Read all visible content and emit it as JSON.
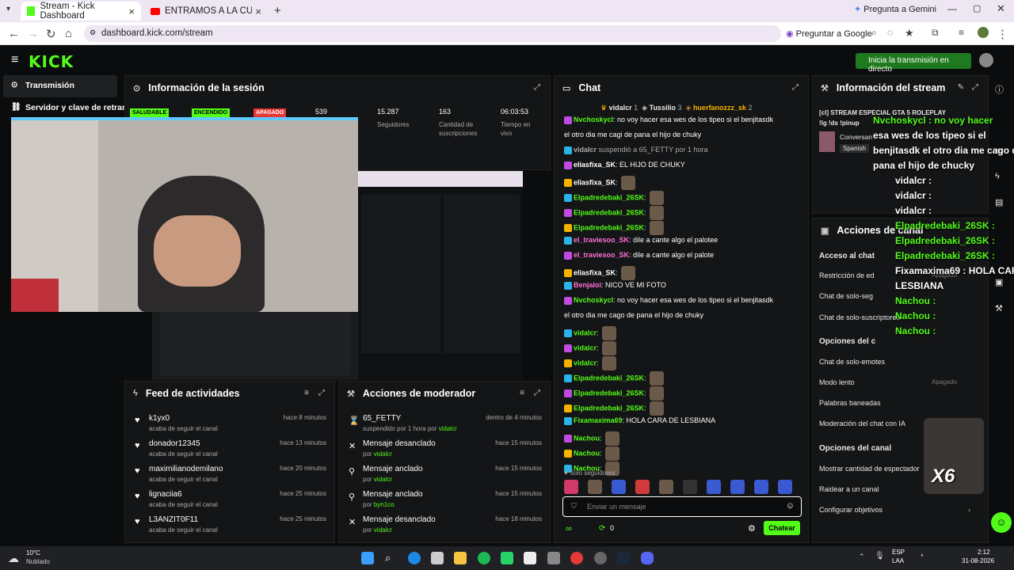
{
  "browser": {
    "tabs": [
      {
        "label": "Stream - Kick Dashboard"
      },
      {
        "label": "ENTRAMOS A LA CUEVA DE LA"
      }
    ],
    "gemini_btn": "Pregunta a Gemini",
    "url": "dashboard.kick.com/stream",
    "ask_google": "Preguntar a Google"
  },
  "kick": {
    "logo": "KICK",
    "start_btn": "Inicia la transmisión en directo"
  },
  "sidebar": {
    "items": [
      {
        "label": "Transmisión"
      },
      {
        "label": "Servidor y clave de retran"
      }
    ]
  },
  "session": {
    "title": "Información de la sesión",
    "tags": [
      "SALUDABLE",
      "ENCENDIDO",
      "APAGADO"
    ],
    "viewers": "539",
    "stats": [
      {
        "value": "15.287",
        "label": "Seguidores"
      },
      {
        "value": "163",
        "label": "Cantidad de suscripciones"
      },
      {
        "value": "06:03:53",
        "label": "Tiempo en vivo"
      }
    ]
  },
  "feed": {
    "title": "Feed de actividades",
    "items": [
      {
        "name": "k1yx0",
        "sub": "acaba de seguir el canal",
        "time": "hace 8 minutos"
      },
      {
        "name": "donador12345",
        "sub": "acaba de seguir el canal",
        "time": "hace 13 minutos"
      },
      {
        "name": "maximilianodemilano",
        "sub": "acaba de seguir el canal",
        "time": "hace 20 minutos"
      },
      {
        "name": "lignaciia6",
        "sub": "acaba de seguir el canal",
        "time": "hace 25 minutos"
      },
      {
        "name": "L3ANZIT0F11",
        "sub": "acaba de seguir el canal",
        "time": "hace 25 minutos"
      }
    ]
  },
  "mod": {
    "title": "Acciones de moderador",
    "items": [
      {
        "name": "65_FETTY",
        "sub": "suspendido por 1 hora por ",
        "by": "vidalcr",
        "time": "dentro de 4 minutos"
      },
      {
        "name": "Mensaje desanclado",
        "sub": "por ",
        "by": "vidalcr",
        "time": "hace 15 minutos"
      },
      {
        "name": "Mensaje anclado",
        "sub": "por ",
        "by": "vidalcr",
        "time": "hace 15 minutos"
      },
      {
        "name": "Mensaje anclado",
        "sub": "por ",
        "by": "byn1co",
        "time": "hace 15 minutos"
      },
      {
        "name": "Mensaje desanclado",
        "sub": "por ",
        "by": "vidalcr",
        "time": "hace 18 minutos"
      }
    ]
  },
  "chat": {
    "title": "Chat",
    "top": [
      {
        "name": "vidalcr",
        "n": "1"
      },
      {
        "name": "Tussilio",
        "n": "3"
      },
      {
        "name": "huerfanozzz_sk",
        "n": "2"
      }
    ],
    "msgs": [
      {
        "user": "Nvchoskycl",
        "color": "#53fc18",
        "text": ": no voy hacer esa wes de los tipeo si el benjitasdk"
      },
      {
        "user": "",
        "color": "#fff",
        "text": "el otro dia me cagi de pana el hijo de chuky"
      },
      {
        "user": "vidalcr",
        "color": "#aaa",
        "text": " suspendió a 65_FETTY por 1 hora"
      },
      {
        "user": "eliasfixa_SK",
        "color": "#fff",
        "text": ": EL HIJO DE CHUKY"
      },
      {
        "user": "eliasfixa_SK",
        "color": "#fff",
        "text": ":"
      },
      {
        "user": "Elpadredebaki_26SK",
        "color": "#53fc18",
        "text": ":"
      },
      {
        "user": "Elpadredebaki_26SK",
        "color": "#53fc18",
        "text": ":"
      },
      {
        "user": "Elpadredebaki_26SK",
        "color": "#53fc18",
        "text": ":"
      },
      {
        "user": "el_traviesoo_SK",
        "color": "#ff6fd8",
        "text": ": dile a cante algo el palotee"
      },
      {
        "user": "el_traviesoo_SK",
        "color": "#ff6fd8",
        "text": ": dile a cante algo el palote"
      },
      {
        "user": "eliasfixa_SK",
        "color": "#fff",
        "text": ":"
      },
      {
        "user": "Benjaloi",
        "color": "#ff6fd8",
        "text": ": NICO VE MI FOTO"
      },
      {
        "user": "Nvchoskycl",
        "color": "#53fc18",
        "text": ": no voy hacer esa wes de los tipeo si el benjitasdk"
      },
      {
        "user": "",
        "color": "#fff",
        "text": "el otro dia me cago de pana el hijo de chuky"
      },
      {
        "user": "vidalcr",
        "color": "#53fc18",
        "text": ":"
      },
      {
        "user": "vidalcr",
        "color": "#53fc18",
        "text": ":"
      },
      {
        "user": "vidalcr",
        "color": "#53fc18",
        "text": ":"
      },
      {
        "user": "Elpadredebaki_26SK",
        "color": "#53fc18",
        "text": ":"
      },
      {
        "user": "Elpadredebaki_26SK",
        "color": "#53fc18",
        "text": ":"
      },
      {
        "user": "Elpadredebaki_26SK",
        "color": "#53fc18",
        "text": ":"
      },
      {
        "user": "Fixamaxima69",
        "color": "#53fc18",
        "text": ": HOLA CARA DE LESBIANA"
      },
      {
        "user": "Nachou",
        "color": "#53fc18",
        "text": ":"
      },
      {
        "user": "Nachou",
        "color": "#53fc18",
        "text": ":"
      },
      {
        "user": "Nachou",
        "color": "#53fc18",
        "text": ":"
      }
    ],
    "followers_only": "Solo seguidores",
    "placeholder": "Enviar un mensaje",
    "send": "Chatear",
    "count": "0"
  },
  "stream_info": {
    "title": "Información del stream",
    "line1": "[cl] STREAM ESPECIAL GTA 5 ROLEPLAY",
    "line2": "!lg !ds !pinup",
    "category": "Conversan",
    "lang": "Spanish"
  },
  "channel": {
    "title": "Acciones de canal",
    "sections": [
      {
        "head": "Acceso al chat",
        "items": [
          "Restricción de ed",
          "Chat de solo-seg",
          "Chat de solo-suscriptores"
        ]
      },
      {
        "head": "Opciones del c",
        "items": [
          "Chat de solo-emotes",
          "Modo lento",
          "Palabras baneadas",
          "Moderación del chat con IA"
        ]
      },
      {
        "head": "Opciones del canal",
        "items": [
          "Mostrar cantidad de espectador",
          "Raidear a un canal",
          "Configurar objetivos"
        ]
      }
    ],
    "apagado": "Apagado"
  },
  "overlay": {
    "lines": [
      "Nvchoskycl : no voy hacer",
      "esa wes de los tipeo si el",
      "benjitasdk el otro dia me cago de",
      "pana el hijo de chucky",
      "vidalcr :",
      "vidalcr :",
      "vidalcr :",
      "Elpadredebaki_26SK :",
      "Elpadredebaki_26SK :",
      "Elpadredebaki_26SK :",
      "Fixamaxima69 : HOLA CARA DE",
      "LESBIANA",
      "Nachou :",
      "Nachou :",
      "Nachou :"
    ],
    "x6": "X6"
  },
  "taskbar": {
    "temp": "10°C",
    "weather": "Nublado",
    "lang": "ESP",
    "lang2": "LAA",
    "time": "2:12",
    "date": "31-08-2026"
  }
}
